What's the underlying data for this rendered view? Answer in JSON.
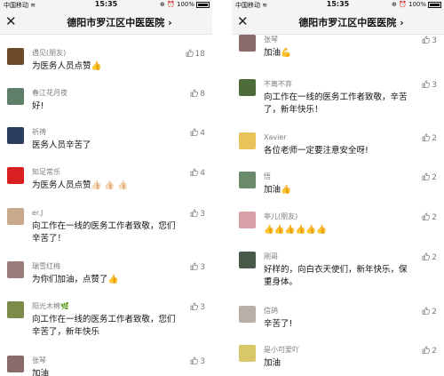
{
  "status_bar": {
    "carrier": "中国移动",
    "time": "15:35",
    "battery": "100%"
  },
  "nav": {
    "close_icon": "close-icon",
    "title": "德阳市罗江区中医医院 ›"
  },
  "left_panel": {
    "comments": [
      {
        "name": "遇见(朋友)",
        "text": "为医务人员点赞👍",
        "likes": "18",
        "avatar_color": "#6b4a2a"
      },
      {
        "name": "春江花月夜",
        "text": "好!",
        "likes": "8",
        "avatar_color": "#5f7f6a"
      },
      {
        "name": "祈祷",
        "text": "医务人员辛苦了",
        "likes": "4",
        "avatar_color": "#2c3e5e"
      },
      {
        "name": "知足常乐",
        "text": "为医务人员点赞👍🏻 👍🏻 👍🏻",
        "likes": "4",
        "avatar_color": "#d92020"
      },
      {
        "name": "er.J",
        "text": "向工作在一线的医务工作者致敬，您们辛苦了！",
        "likes": "3",
        "avatar_color": "#c9a98c"
      },
      {
        "name": "瑞雪红梅",
        "text": "为你们加油，点赞了👍",
        "likes": "3",
        "avatar_color": "#9a7c7c"
      },
      {
        "name": "阳光木棉🌿",
        "text": "向工作在一线的医务工作者致敬，您们辛苦了，新年快乐",
        "likes": "3",
        "avatar_color": "#7a8b4a"
      },
      {
        "name": "张琴",
        "text": "加油",
        "likes": "3",
        "avatar_color": "#8a6a6a"
      }
    ]
  },
  "right_panel": {
    "comments": [
      {
        "name": "张琴",
        "text": "加油💪",
        "likes": "3",
        "avatar_color": "#8a6a6a"
      },
      {
        "name": "不离不弃",
        "text": "向工作在一线的医务工作者致敬，辛苦了，新年快乐！",
        "likes": "3",
        "avatar_color": "#4e6b3a"
      },
      {
        "name": "Xavier",
        "text": "各位老师一定要注意安全呀!",
        "likes": "2",
        "avatar_color": "#e8c35a"
      },
      {
        "name": "悟",
        "text": "加油👍",
        "likes": "2",
        "avatar_color": "#6b8a6b"
      },
      {
        "name": "亭儿(朋友)",
        "text": "👍👍👍👍👍👍",
        "likes": "2",
        "avatar_color": "#d8a0a8"
      },
      {
        "name": "刚哥",
        "text": "好样的，向白衣天使们，新年快乐，保重身体。",
        "likes": "2",
        "avatar_color": "#4a5a4a"
      },
      {
        "name": "信鸽",
        "text": "辛苦了!",
        "likes": "2",
        "avatar_color": "#b8b0a8"
      },
      {
        "name": "是小可爱吖",
        "text": "加油",
        "likes": "2",
        "avatar_color": "#d8c86a"
      }
    ]
  }
}
